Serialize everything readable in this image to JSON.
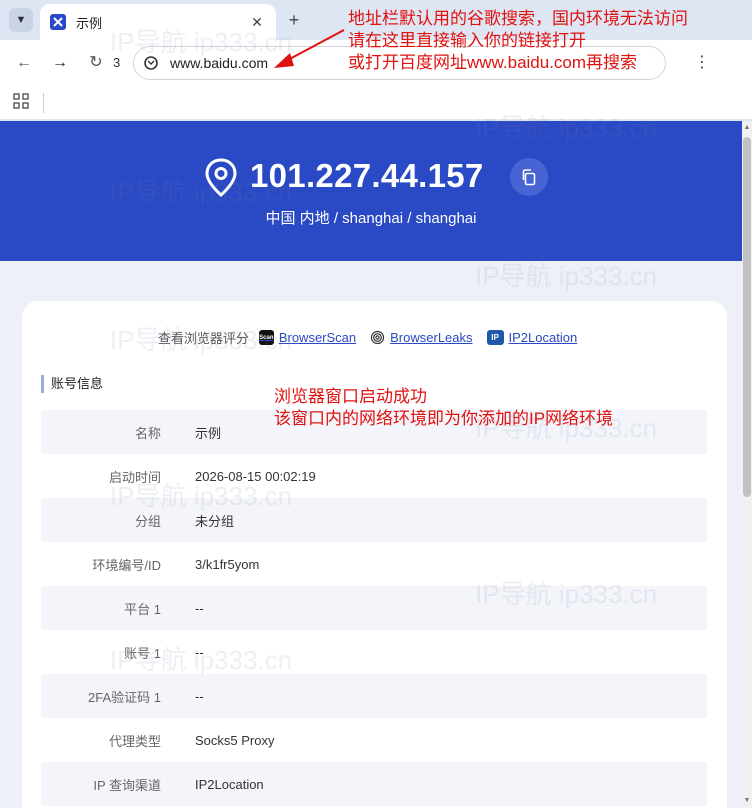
{
  "browser": {
    "tab": {
      "title": "示例"
    },
    "nav_history_count": "3",
    "address": {
      "url": "www.baidu.com"
    }
  },
  "hero": {
    "ip": "101.227.44.157",
    "location": "中国 内地 / shanghai / shanghai"
  },
  "score": {
    "label": "查看浏览器评分",
    "links": [
      {
        "label": "BrowserScan"
      },
      {
        "label": "BrowserLeaks"
      },
      {
        "label": "IP2Location"
      }
    ]
  },
  "account": {
    "section_title": "账号信息",
    "rows": [
      {
        "label": "名称",
        "value": "示例"
      },
      {
        "label": "启动时间",
        "value": "2026-08-15 00:02:19"
      },
      {
        "label": "分组",
        "value": "未分组"
      },
      {
        "label": "环境编号/ID",
        "value": "3/k1fr5yom"
      },
      {
        "label": "平台 1",
        "value": "--"
      },
      {
        "label": "账号 1",
        "value": "--"
      },
      {
        "label": "2FA验证码 1",
        "value": "--"
      },
      {
        "label": "代理类型",
        "value": "Socks5 Proxy"
      },
      {
        "label": "IP 查询渠道",
        "value": "IP2Location"
      }
    ]
  },
  "annotations": {
    "top_lines": [
      "地址栏默认用的谷歌搜索，国内环境无法访问",
      "请在这里直接输入你的链接打开",
      "或打开百度网址www.baidu.com再搜索"
    ],
    "mid_lines": [
      "浏览器窗口启动成功",
      "该窗口内的网络环境即为你添加的IP网络环境"
    ]
  },
  "watermark": "IP导航 ip333.cn",
  "colors": {
    "brand_blue": "#2a49c4",
    "annotation_red": "#e0120f"
  },
  "icons": {
    "hero_pin": "location-pin-icon",
    "hero_copy": "copy-icon",
    "site_info": "site-info-icon"
  }
}
